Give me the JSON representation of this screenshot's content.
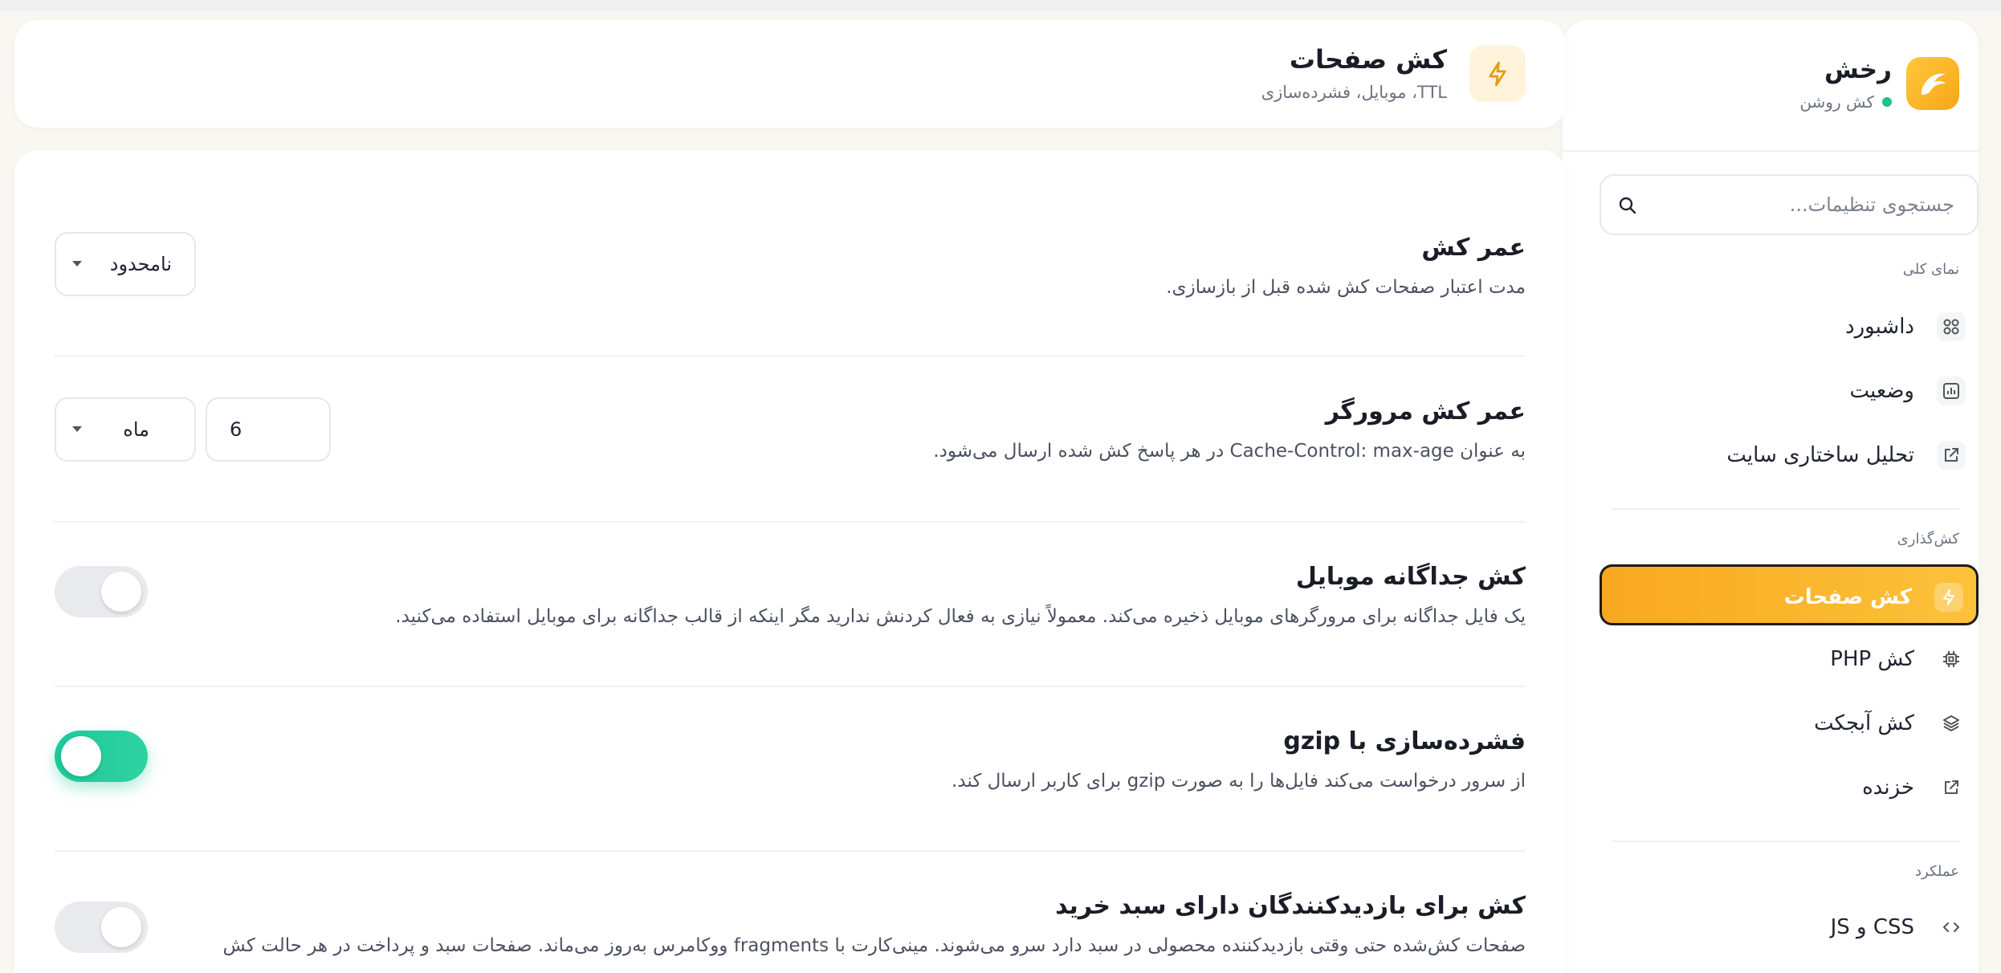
{
  "brand": {
    "name": "رخش",
    "status": "کش روشن"
  },
  "search": {
    "placeholder": "جستجوی تنظیمات..."
  },
  "sidebar": {
    "sections": [
      {
        "label": "نمای کلی",
        "items": [
          {
            "label": "داشبورد",
            "icon": "grid-icon"
          },
          {
            "label": "وضعیت",
            "icon": "chart-icon"
          },
          {
            "label": "تحلیل ساختاری سایت",
            "icon": "external-link-icon"
          }
        ]
      },
      {
        "label": "کش‌گذاری",
        "items": [
          {
            "label": "کش صفحات",
            "icon": "bolt-icon",
            "active": true
          },
          {
            "label": "کش PHP",
            "icon": "chip-icon"
          },
          {
            "label": "کش آبجکت",
            "icon": "layers-icon"
          },
          {
            "label": "خزنده",
            "icon": "external-link-icon"
          }
        ]
      },
      {
        "label": "عملکرد",
        "items": [
          {
            "label": "CSS و JS",
            "icon": "code-icon"
          }
        ]
      }
    ]
  },
  "header": {
    "title": "کش صفحات",
    "subtitle": "TTL، موبایل، فشرده‌سازی"
  },
  "settings": {
    "cache_lifetime": {
      "title": "عمر کش",
      "desc": "مدت اعتبار صفحات کش شده قبل از بازسازی.",
      "select_value": "نامحدود"
    },
    "browser_cache": {
      "title": "عمر کش مرورگر",
      "desc": "به عنوان Cache-Control: max-age در هر پاسخ کش شده ارسال می‌شود.",
      "number_value": "6",
      "unit_value": "ماه"
    },
    "mobile_cache": {
      "title": "کش جداگانه موبایل",
      "desc": "یک فایل جداگانه برای مرورگرهای موبایل ذخیره می‌کند. معمولاً نیازی به فعال کردنش ندارید مگر اینکه از قالب جداگانه برای موبایل استفاده می‌کنید.",
      "enabled": false
    },
    "gzip": {
      "title": "فشرده‌سازی با gzip",
      "desc": "از سرور درخواست می‌کند فایل‌ها را به صورت gzip برای کاربر ارسال کند.",
      "enabled": true
    },
    "cart_visitors": {
      "title": "کش برای بازدیدکنندگان دارای سبد خرید",
      "desc": "صفحات کش‌شده حتی وقتی بازدیدکننده محصولی در سبد دارد سرو می‌شوند. مینی‌کارت با fragments ووکامرس به‌روز می‌ماند. صفحات سبد و پرداخت در هر حالت کش",
      "enabled": false
    }
  },
  "colors": {
    "accent": "#f8a820",
    "toggle_on": "#1fc79a",
    "status_dot": "#22c08a"
  }
}
